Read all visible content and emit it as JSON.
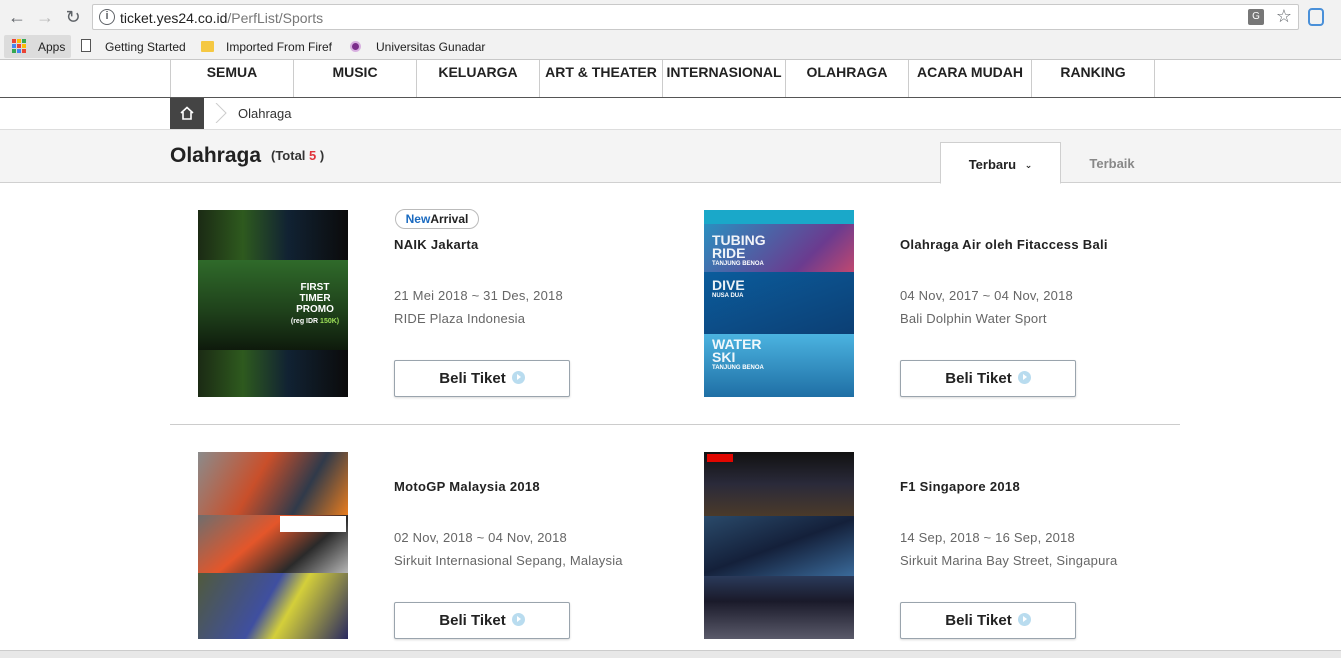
{
  "browser": {
    "url_host": "ticket.yes24.co.id",
    "url_path": "/PerfList/Sports",
    "bookmarks": [
      {
        "label": "Apps"
      },
      {
        "label": "Getting Started"
      },
      {
        "label": "Imported From Firef"
      },
      {
        "label": "Universitas Gunadar"
      }
    ]
  },
  "nav": {
    "items": [
      "SEMUA",
      "MUSIC",
      "KELUARGA",
      "ART & THEATER",
      "INTERNASIONAL",
      "OLAHRAGA",
      "ACARA MUDAH",
      "RANKING"
    ]
  },
  "breadcrumb": {
    "current": "Olahraga"
  },
  "header": {
    "title": "Olahraga",
    "total_prefix": "(Total ",
    "total_count": "5",
    "total_suffix": " )"
  },
  "tabs": {
    "active": "Terbaru",
    "inactive": "Terbaik"
  },
  "events": [
    {
      "badge_new": "New",
      "badge_arrival": "Arrival",
      "title": "NAIK Jakarta",
      "date": "21 Mei 2018 ~ 31 Des, 2018",
      "venue": "RIDE Plaza Indonesia",
      "button": "Beli Tiket",
      "img_text_1": "FIRST",
      "img_text_2": "TIMER",
      "img_text_3": "PROMO",
      "img_text_4": "(reg IDR ",
      "img_text_5": "150K)"
    },
    {
      "title": "Olahraga Air oleh Fitaccess Bali",
      "date": "04 Nov, 2017 ~ 04 Nov, 2018",
      "venue": "Bali Dolphin Water Sport",
      "button": "Beli Tiket",
      "img_labels": [
        "TUBING",
        "RIDE",
        "DIVE",
        "WATER",
        "SKI"
      ],
      "img_sub": [
        "TANJUNG BENOA",
        "NUSA DUA",
        "TANJUNG BENOA"
      ]
    },
    {
      "title": "MotoGP Malaysia 2018",
      "date": "02 Nov, 2018 ~ 04 Nov, 2018",
      "venue": "Sirkuit Internasional Sepang, Malaysia",
      "button": "Beli Tiket"
    },
    {
      "title": "F1 Singapore 2018",
      "date": "14 Sep, 2018 ~ 16 Sep, 2018",
      "venue": "Sirkuit Marina Bay Street, Singapura",
      "button": "Beli Tiket"
    }
  ],
  "colors": {
    "accent_red": "#e0343b",
    "badge_blue": "#1a6ac0",
    "home_bg": "#444444"
  }
}
